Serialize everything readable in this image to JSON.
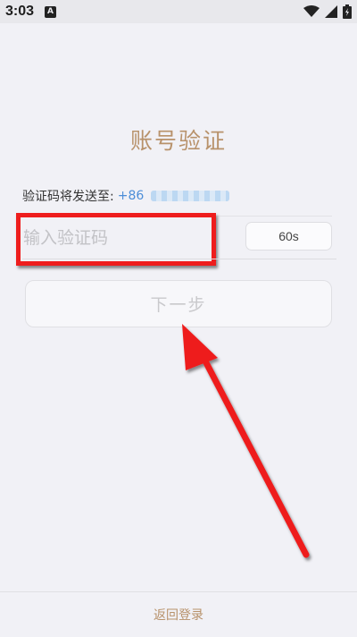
{
  "status_bar": {
    "time": "3:03",
    "notification_badge": "A",
    "icons": [
      "wifi-icon",
      "signal-icon",
      "battery-icon"
    ]
  },
  "page": {
    "title": "账号验证",
    "send_prefix": "验证码将发送至:",
    "phone_code": "+86",
    "code_placeholder": "输入验证码",
    "timer_label": "60s",
    "next_label": "下一步",
    "back_login_label": "返回登录"
  },
  "colors": {
    "accent": "#b8926b",
    "link": "#4d8ed8",
    "annotation": "#ee1d1d",
    "background": "#f1f1f6"
  }
}
